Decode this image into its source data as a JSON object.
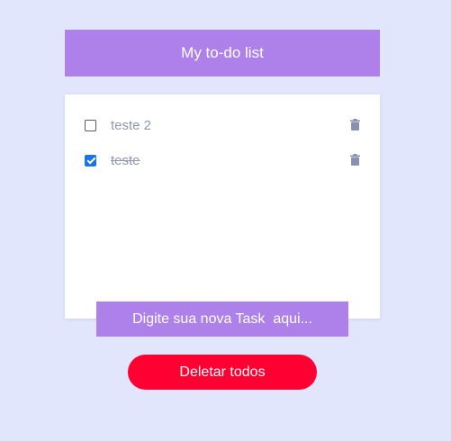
{
  "header": {
    "title": "My to-do list"
  },
  "tasks": [
    {
      "label": "teste 2",
      "done": false
    },
    {
      "label": "teste",
      "done": true
    }
  ],
  "input": {
    "value": "Digite sua nova Task  aqui..."
  },
  "actions": {
    "delete_all_label": "Deletar todos"
  },
  "colors": {
    "background": "#e1e6fc",
    "accent": "#ae81ea",
    "danger": "#ff0033",
    "muted_text": "#8f97b3",
    "trash_icon": "#8a90b0"
  },
  "icons": {
    "delete_task": "trash-icon"
  }
}
